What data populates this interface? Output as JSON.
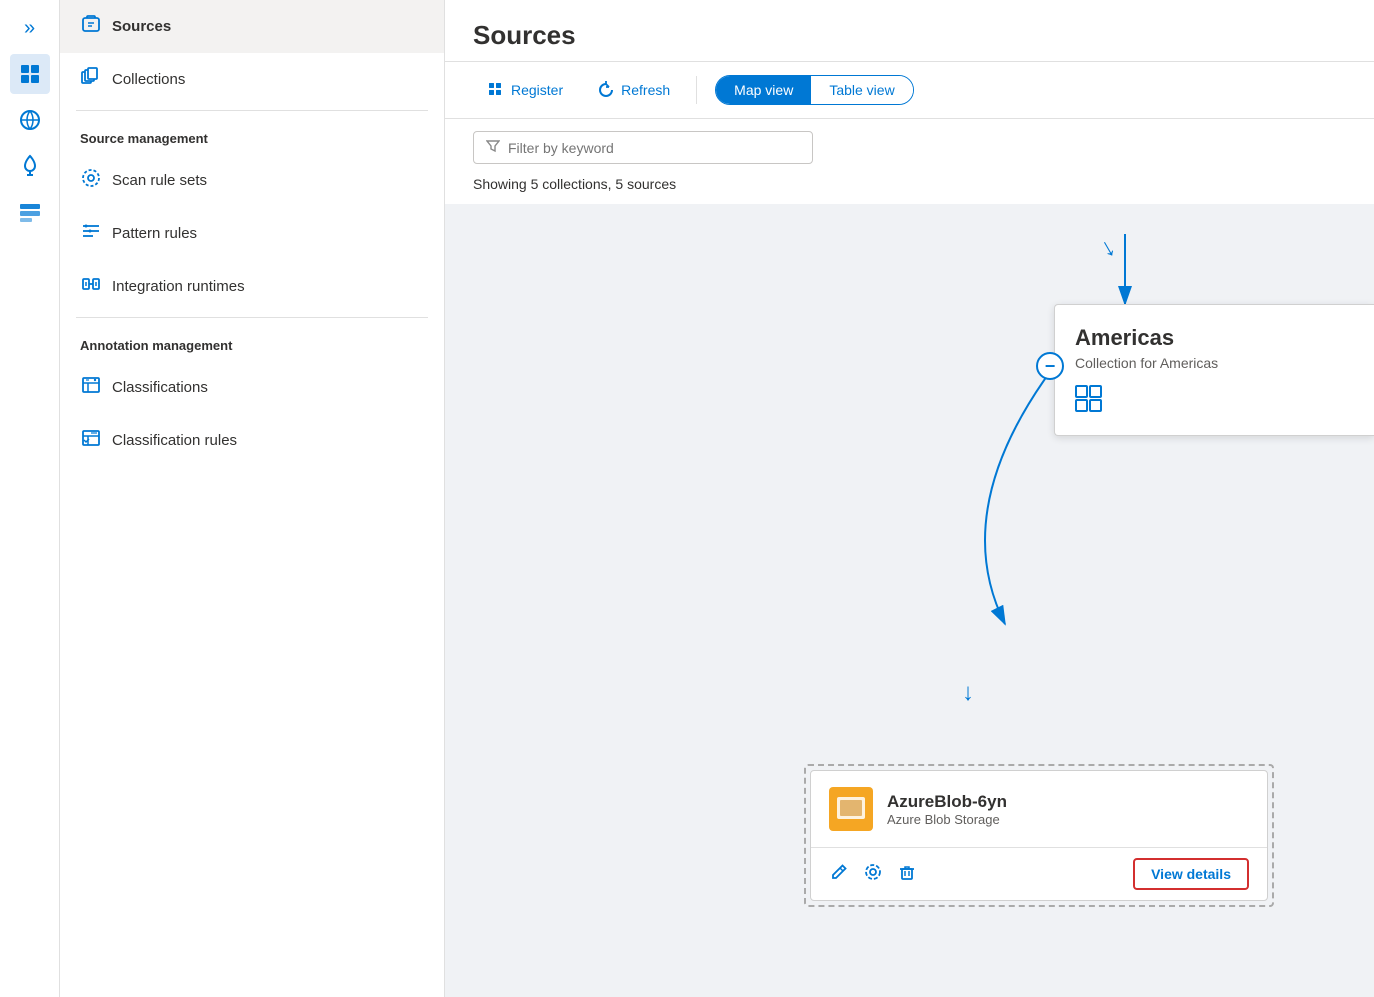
{
  "iconBar": {
    "items": [
      {
        "name": "chevron-right-icon",
        "symbol": "»"
      },
      {
        "name": "catalog-icon",
        "symbol": "🗂"
      },
      {
        "name": "nav-icon-2",
        "symbol": "✦"
      },
      {
        "name": "nav-icon-3",
        "symbol": "⚙"
      },
      {
        "name": "nav-icon-4",
        "symbol": "🧰"
      }
    ]
  },
  "nav": {
    "sources_label": "Sources",
    "collections_label": "Collections",
    "source_management_label": "Source management",
    "scan_rule_sets_label": "Scan rule sets",
    "pattern_rules_label": "Pattern rules",
    "integration_runtimes_label": "Integration runtimes",
    "annotation_management_label": "Annotation management",
    "classifications_label": "Classifications",
    "classification_rules_label": "Classification rules"
  },
  "main": {
    "title": "Sources",
    "toolbar": {
      "register_label": "Register",
      "refresh_label": "Refresh",
      "map_view_label": "Map view",
      "table_view_label": "Table view"
    },
    "filter": {
      "placeholder": "Filter by keyword"
    },
    "showing_text": "Showing 5 collections, 5 sources",
    "americas_card": {
      "title": "Americas",
      "subtitle": "Collection for Americas",
      "icon": "⊞"
    },
    "blob_card": {
      "name": "AzureBlob-6yn",
      "type": "Azure Blob Storage",
      "view_details_label": "View details"
    }
  }
}
